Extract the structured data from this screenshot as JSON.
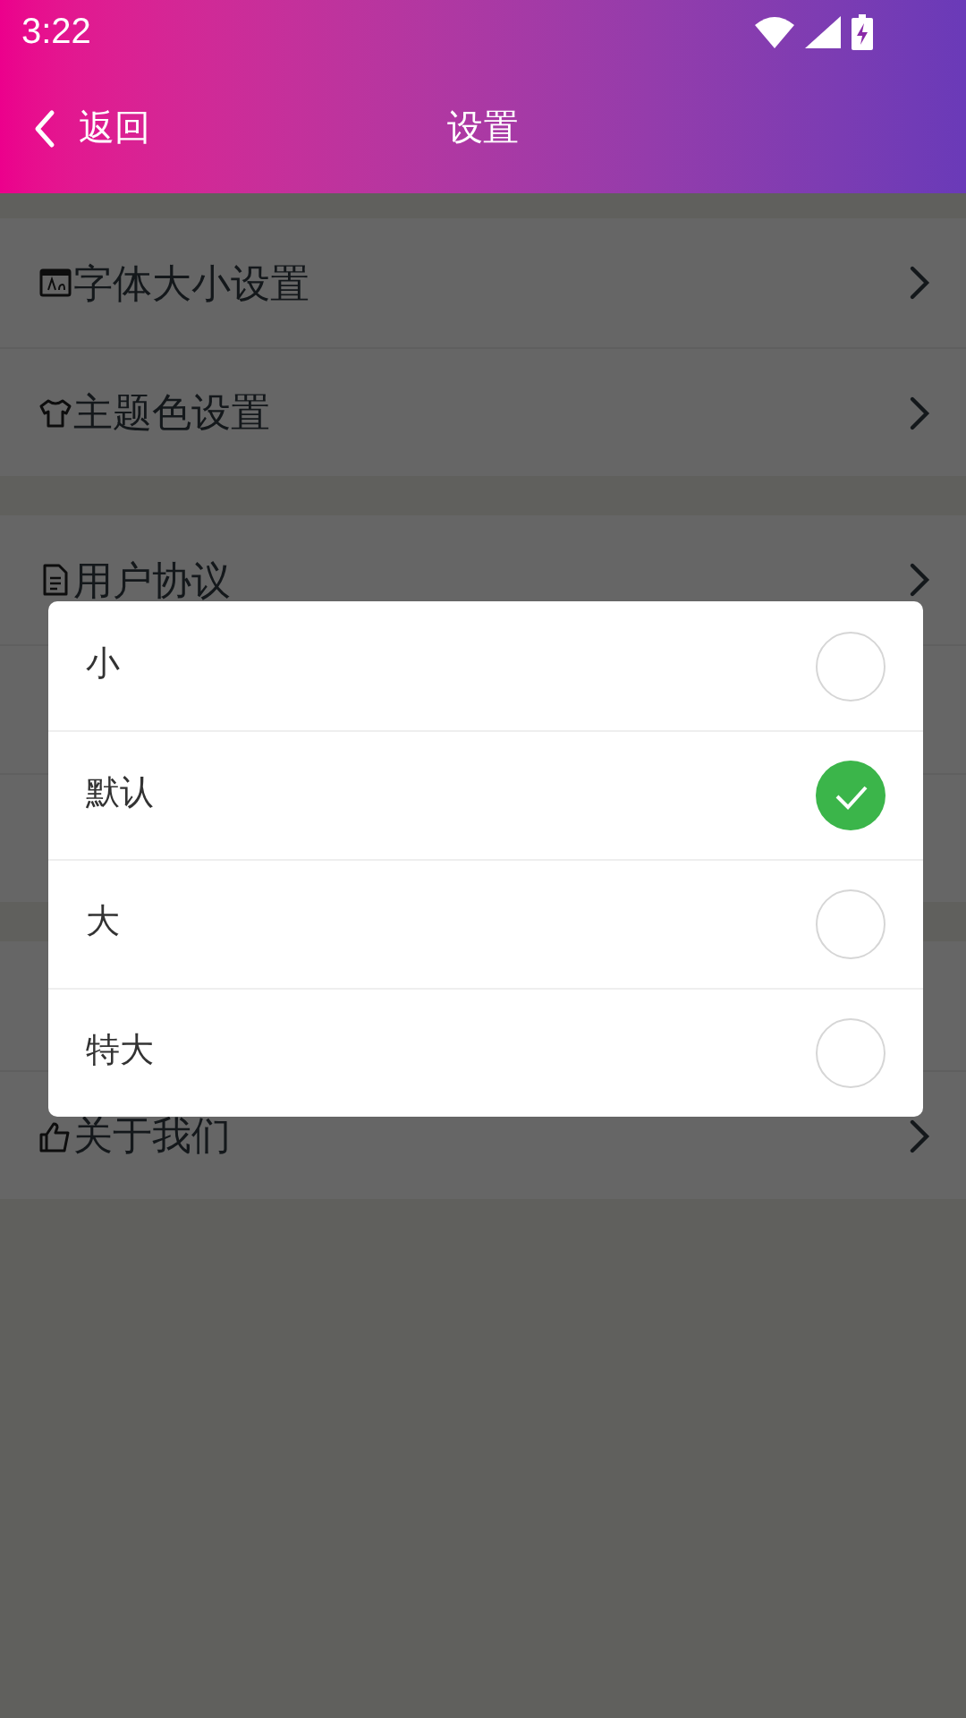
{
  "status_bar": {
    "time": "3:22"
  },
  "nav": {
    "back": "返回",
    "title": "设置"
  },
  "settings_groups": [
    {
      "items": [
        {
          "kind": "font",
          "label": "字体大小设置"
        },
        {
          "kind": "theme",
          "label": "主题色设置"
        }
      ]
    },
    {
      "items": [
        {
          "kind": "doc",
          "label": "用户协议"
        },
        {
          "kind": "covered"
        },
        {
          "kind": "covered"
        }
      ]
    },
    {
      "items": [
        {
          "kind": "covered"
        },
        {
          "kind": "like",
          "label": "关于我们"
        }
      ]
    }
  ],
  "font_size_dialog": {
    "options": [
      {
        "label": "小",
        "selected": false
      },
      {
        "label": "默认",
        "selected": true
      },
      {
        "label": "大",
        "selected": false
      },
      {
        "label": "特大",
        "selected": false
      }
    ]
  }
}
